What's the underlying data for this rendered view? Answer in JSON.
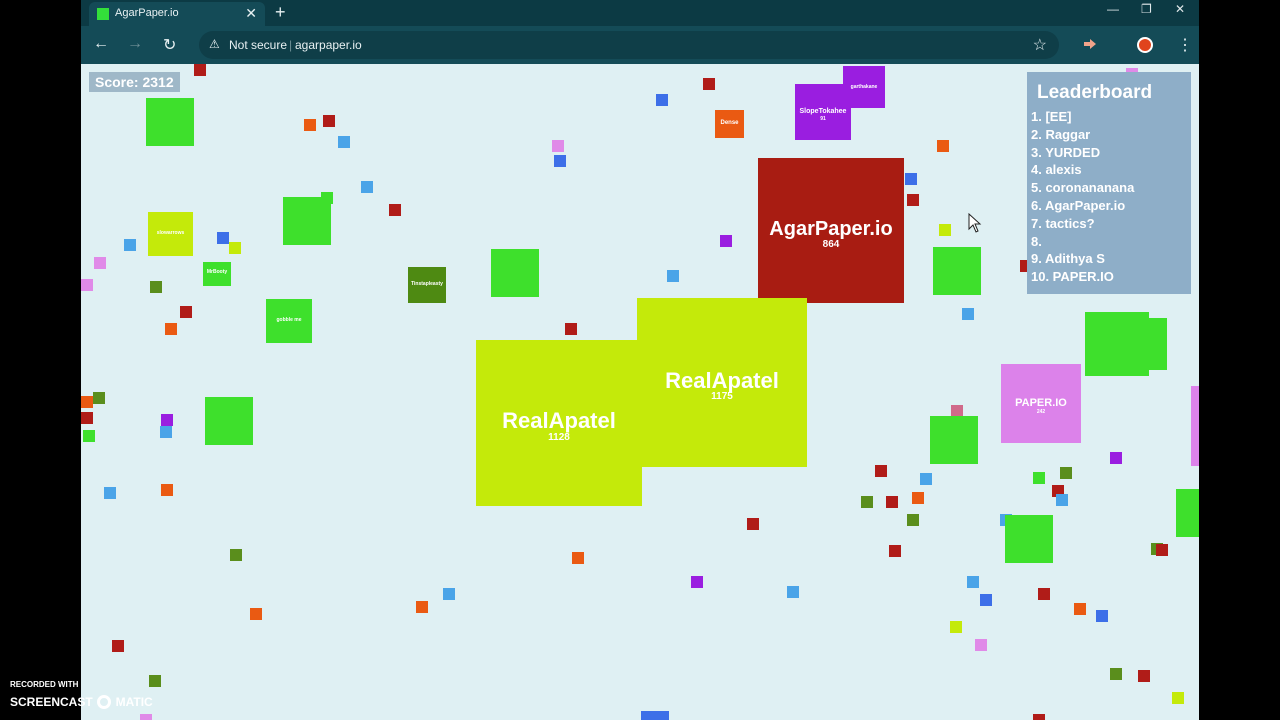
{
  "browser": {
    "tab_title": "AgarPaper.io",
    "tab_close": "✕",
    "new_tab": "+",
    "window_controls": [
      "—",
      "❐",
      "✕"
    ],
    "nav": {
      "back": "←",
      "forward": "→",
      "reload": "↻"
    },
    "security_icon": "⚠",
    "security_label": "Not secure",
    "separator": "|",
    "url": "agarpaper.io",
    "star": "☆",
    "menu": "⋮"
  },
  "game": {
    "score_label": "Score: 2312",
    "leaderboard": {
      "title": "Leaderboard",
      "entries": [
        "1. [EE]",
        "2. Raggar",
        "3. YURDED",
        "4. alexis",
        "5. coronananana",
        "6. AgarPaper.io",
        "7. tactics?",
        "8.",
        "9. Adithya S",
        "10. PAPER.IO"
      ]
    },
    "cells": {
      "agarpaper": {
        "name": "AgarPaper.io",
        "mass": "864",
        "color": "#a81c12"
      },
      "realapatel_left": {
        "name": "RealApatel",
        "mass": "1128",
        "color": "#c4ea0a"
      },
      "realapatel_right": {
        "name": "RealApatel",
        "mass": "1175",
        "color": "#c4ea0a"
      },
      "paperio": {
        "name": "PAPER.IO",
        "mass": "242",
        "color": "#dc82ea"
      },
      "slope": {
        "name": "SlopeTokahee",
        "mass": "91",
        "color": "#9a1ee0"
      },
      "purple_small": {
        "name": "garthakane",
        "mass": "",
        "color": "#9a1ee0"
      },
      "orange": {
        "name": "Dense",
        "mass": "",
        "color": "#ea5a12"
      },
      "yellow_small": {
        "name": "slowarrows",
        "mass": "",
        "color": "#c4ea0a"
      },
      "olive": {
        "name": "Tinstapleasty",
        "mass": "",
        "color": "#4e8a12"
      },
      "green_small1": {
        "name": "MrBooty",
        "mass": "",
        "color": "#3ee02c"
      },
      "green_small2": {
        "name": "gobble me",
        "mass": "",
        "color": "#3ee02c"
      }
    },
    "colors": {
      "background": "#dff0f3",
      "green": "#3ee02c",
      "red": "#b01c18",
      "orange": "#ea5a12",
      "blue": "#4aa4e8",
      "purple": "#9a1ee0",
      "olive": "#5a8e1c",
      "pink": "#e08ae8"
    }
  },
  "watermark": {
    "line1": "RECORDED WITH",
    "line2": "SCREENCAST",
    "line3": "MATIC"
  }
}
